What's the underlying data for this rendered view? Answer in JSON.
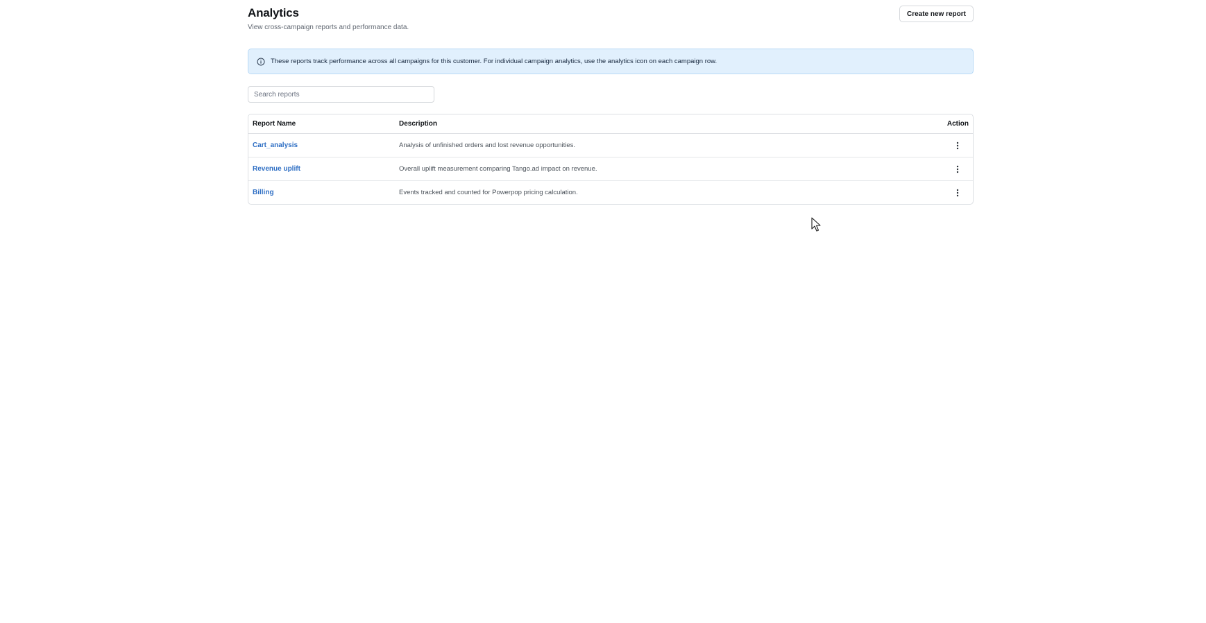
{
  "header": {
    "title": "Analytics",
    "subtitle": "View cross-campaign reports and performance data.",
    "create_button_label": "Create new report"
  },
  "banner": {
    "icon": "info-icon",
    "text": "These reports track performance across all campaigns for this customer. For individual campaign analytics, use the analytics icon on each campaign row.",
    "background_color": "#e1f0fd",
    "border_color": "#b8d9f6"
  },
  "search": {
    "placeholder": "Search reports",
    "value": ""
  },
  "table": {
    "columns": {
      "name": "Report Name",
      "description": "Description",
      "action": "Action"
    },
    "rows": [
      {
        "name": "Cart_analysis",
        "description": "Analysis of unfinished orders and lost revenue opportunities.",
        "action_icon": "more-vertical-icon"
      },
      {
        "name": "Revenue uplift",
        "description": "Overall uplift measurement comparing Tango.ad impact on revenue.",
        "action_icon": "more-vertical-icon"
      },
      {
        "name": "Billing",
        "description": "Events tracked and counted for Powerpop pricing calculation.",
        "action_icon": "more-vertical-icon"
      }
    ]
  },
  "colors": {
    "link": "#2f6fc4",
    "title": "#111418"
  }
}
